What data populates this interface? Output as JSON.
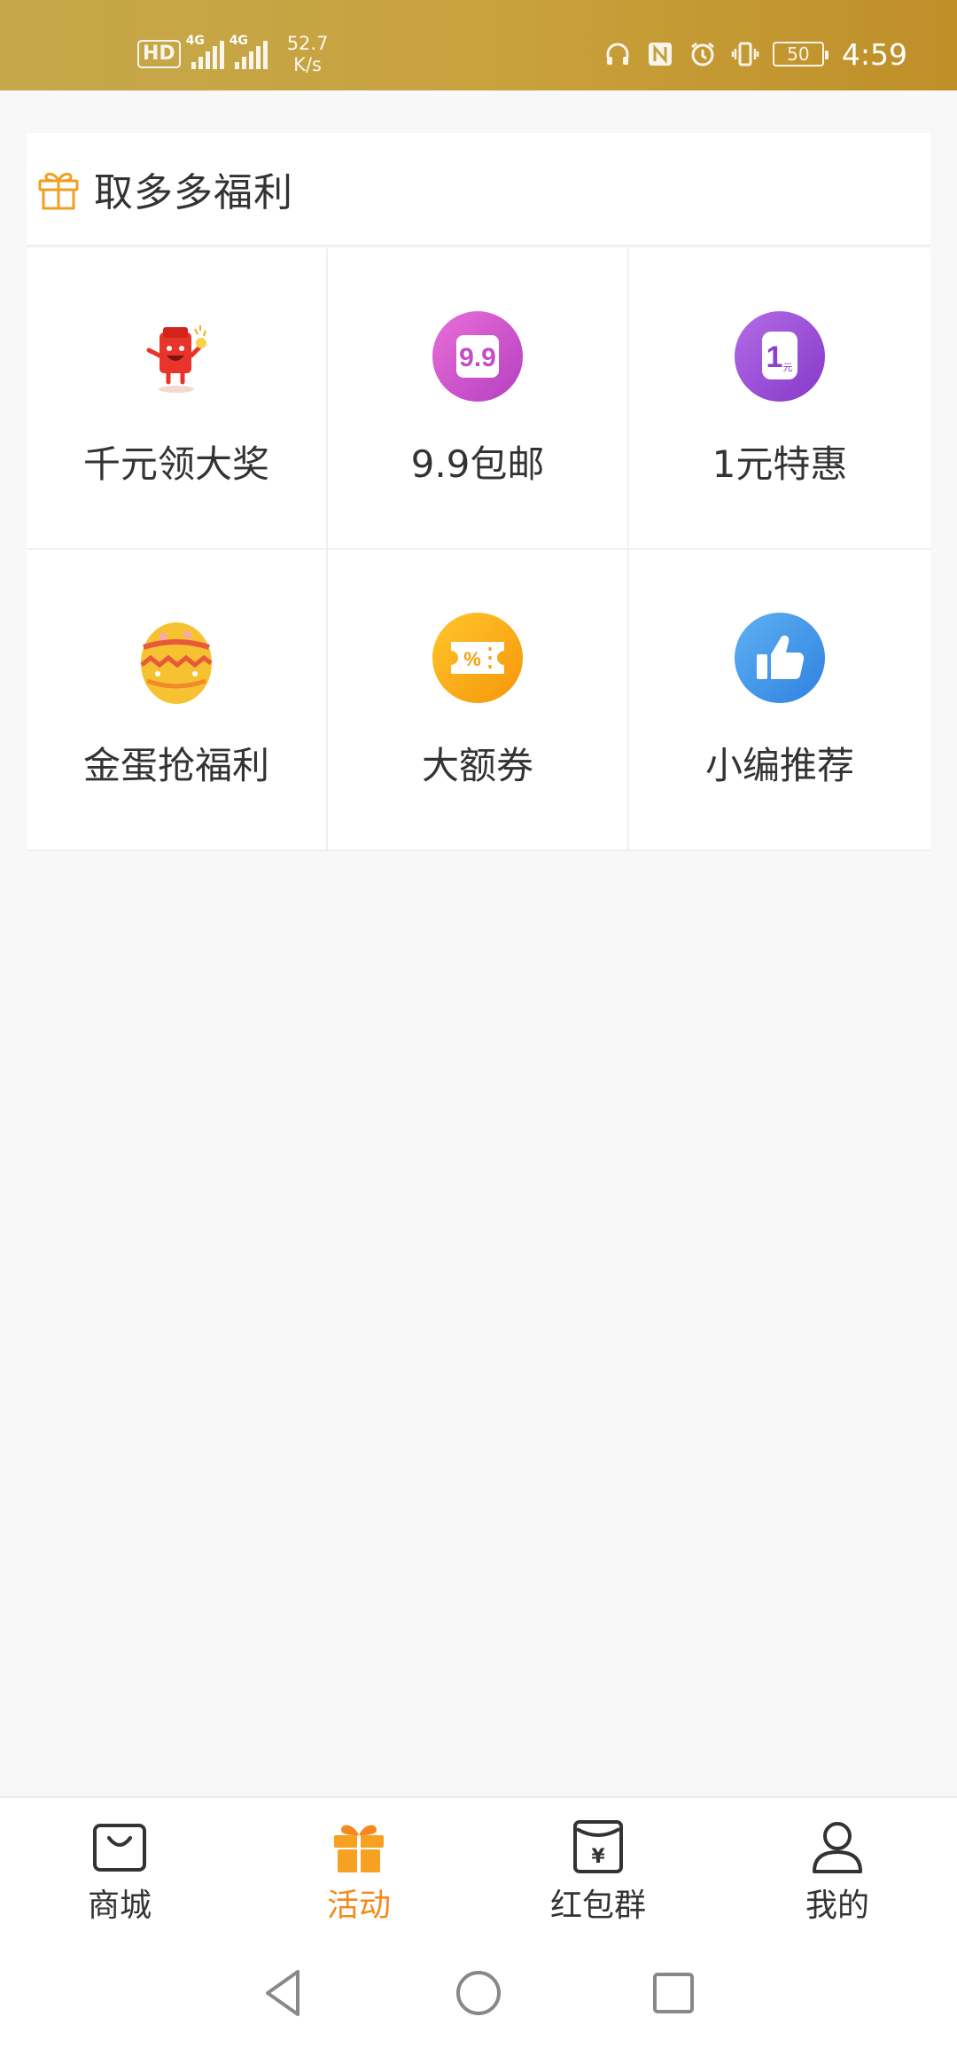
{
  "status_bar": {
    "hd_label": "HD",
    "sim1_tag": "4G",
    "sim2_tag": "4G",
    "speed_value": "52.7",
    "speed_unit": "K/s",
    "battery": "50",
    "time": "4:59"
  },
  "section": {
    "title": "取多多福利",
    "title_icon": "gift-icon",
    "accent_color": "#f0a020"
  },
  "grid_items": [
    {
      "label": "千元领大奖",
      "icon": "red-packet-mascot-icon",
      "color": "#e8342a"
    },
    {
      "label": "9.9包邮",
      "icon": "price-9-9-icon",
      "color": "#d04fc9"
    },
    {
      "label": "1元特惠",
      "icon": "one-yuan-icon",
      "color": "#9a4ad6"
    },
    {
      "label": "金蛋抢福利",
      "icon": "golden-egg-icon",
      "color": "#f6c233"
    },
    {
      "label": "大额券",
      "icon": "coupon-icon",
      "color": "#f8a712"
    },
    {
      "label": "小编推荐",
      "icon": "thumbs-up-icon",
      "color": "#3a95e8"
    }
  ],
  "bottom_nav": {
    "active_color": "#f48a1d",
    "items": [
      {
        "label": "商城",
        "icon": "shopping-bag-icon"
      },
      {
        "label": "活动",
        "icon": "gift-box-icon"
      },
      {
        "label": "红包群",
        "icon": "red-envelope-yuan-icon"
      },
      {
        "label": "我的",
        "icon": "person-icon"
      }
    ]
  }
}
